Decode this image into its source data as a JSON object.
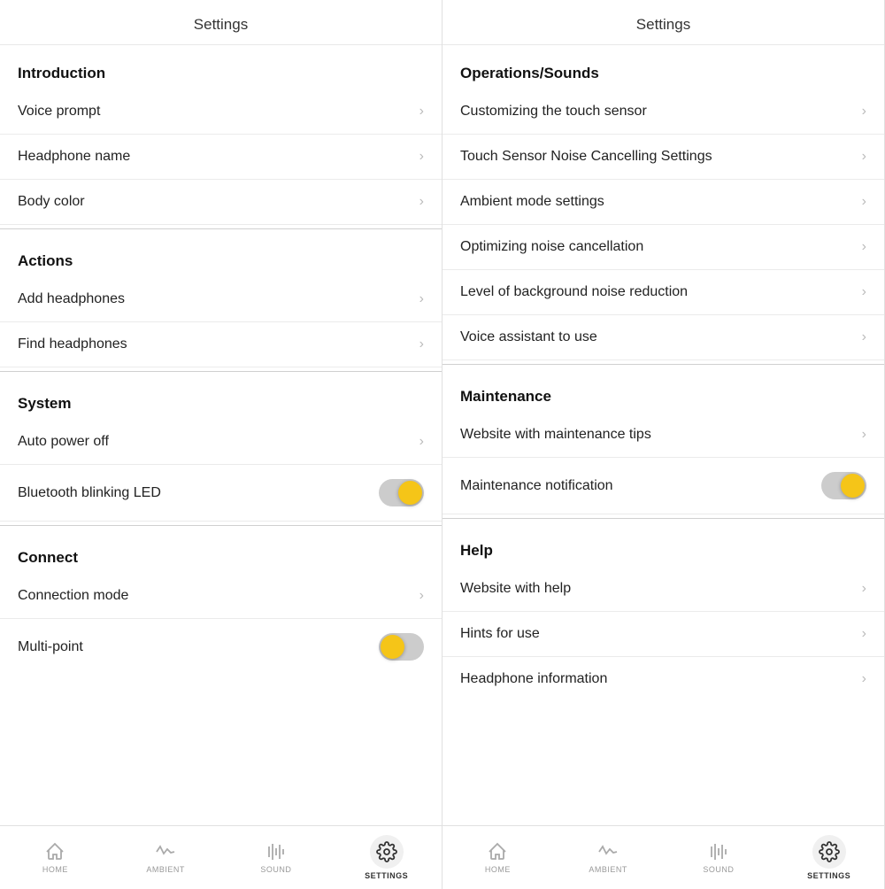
{
  "left_panel": {
    "header": "Settings",
    "sections": [
      {
        "title": "Introduction",
        "items": [
          {
            "label": "Voice prompt",
            "type": "nav"
          },
          {
            "label": "Headphone name",
            "type": "nav"
          },
          {
            "label": "Body color",
            "type": "nav"
          }
        ]
      },
      {
        "title": "Actions",
        "items": [
          {
            "label": "Add headphones",
            "type": "nav"
          },
          {
            "label": "Find headphones",
            "type": "nav"
          }
        ]
      },
      {
        "title": "System",
        "items": [
          {
            "label": "Auto power off",
            "type": "nav"
          },
          {
            "label": "Bluetooth blinking LED",
            "type": "toggle",
            "value": true
          }
        ]
      },
      {
        "title": "Connect",
        "items": [
          {
            "label": "Connection mode",
            "type": "nav"
          },
          {
            "label": "Multi-point",
            "type": "toggle",
            "value": false
          }
        ]
      }
    ],
    "bottom_nav": [
      {
        "label": "HOME",
        "icon": "home",
        "active": false
      },
      {
        "label": "AMBIENT",
        "icon": "ambient",
        "active": false
      },
      {
        "label": "SOUND",
        "icon": "sound",
        "active": false
      },
      {
        "label": "SETTINGS",
        "icon": "settings",
        "active": true
      }
    ]
  },
  "right_panel": {
    "header": "Settings",
    "sections": [
      {
        "title": "Operations/Sounds",
        "items": [
          {
            "label": "Customizing the touch sensor",
            "type": "nav"
          },
          {
            "label": "Touch Sensor Noise Cancelling Settings",
            "type": "nav"
          },
          {
            "label": "Ambient mode settings",
            "type": "nav"
          },
          {
            "label": "Optimizing noise cancellation",
            "type": "nav"
          },
          {
            "label": "Level of background noise reduction",
            "type": "nav"
          },
          {
            "label": "Voice assistant to use",
            "type": "nav"
          }
        ]
      },
      {
        "title": "Maintenance",
        "items": [
          {
            "label": "Website with maintenance tips",
            "type": "nav"
          },
          {
            "label": "Maintenance notification",
            "type": "toggle",
            "value": true
          }
        ]
      },
      {
        "title": "Help",
        "items": [
          {
            "label": "Website with help",
            "type": "nav"
          },
          {
            "label": "Hints for use",
            "type": "nav"
          },
          {
            "label": "Headphone information",
            "type": "nav"
          }
        ]
      }
    ],
    "bottom_nav": [
      {
        "label": "HOME",
        "icon": "home",
        "active": false
      },
      {
        "label": "AMBIENT",
        "icon": "ambient",
        "active": false
      },
      {
        "label": "SOUND",
        "icon": "sound",
        "active": false
      },
      {
        "label": "SETTINGS",
        "icon": "settings",
        "active": true
      }
    ]
  }
}
